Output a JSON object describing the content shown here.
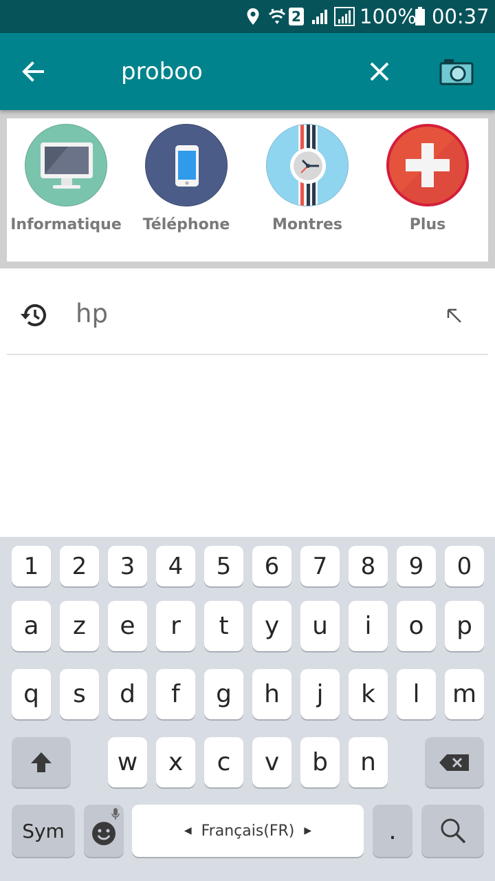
{
  "status_bar": {
    "sim_badge": "2",
    "battery_percent": "100%",
    "time": "00:37",
    "icons": [
      "location-icon",
      "wifi-icon",
      "sim-2-icon",
      "signal-icon",
      "signal-icon",
      "battery-icon"
    ]
  },
  "app_bar": {
    "query": "proboo",
    "color": "#00838c",
    "icons": [
      "back-arrow-icon",
      "close-icon",
      "camera-icon"
    ]
  },
  "categories": [
    {
      "label": "Informatique",
      "icon": "monitor-icon",
      "color": "#7ac4ae"
    },
    {
      "label": "Téléphone",
      "icon": "smartphone-icon",
      "color": "#4b5c88"
    },
    {
      "label": "Montres",
      "icon": "watch-icon",
      "color": "#90d5f0"
    },
    {
      "label": "Plus",
      "icon": "plus-icon",
      "color": "#e5533c"
    }
  ],
  "suggestions": [
    {
      "text": "hp",
      "icon": "history-icon",
      "action_icon": "arrow-up-left-icon"
    }
  ],
  "keyboard": {
    "numbers": [
      "1",
      "2",
      "3",
      "4",
      "5",
      "6",
      "7",
      "8",
      "9",
      "0"
    ],
    "row1": [
      "a",
      "z",
      "e",
      "r",
      "t",
      "y",
      "u",
      "i",
      "o",
      "p"
    ],
    "row2": [
      "q",
      "s",
      "d",
      "f",
      "g",
      "h",
      "j",
      "k",
      "l",
      "m"
    ],
    "row3": [
      "w",
      "x",
      "c",
      "v",
      "b",
      "n"
    ],
    "sym_label": "Sym",
    "space_label": "Français(FR)",
    "period": ".",
    "icons": [
      "shift-icon",
      "backspace-icon",
      "emoji-icon",
      "mic-icon",
      "search-icon"
    ]
  }
}
